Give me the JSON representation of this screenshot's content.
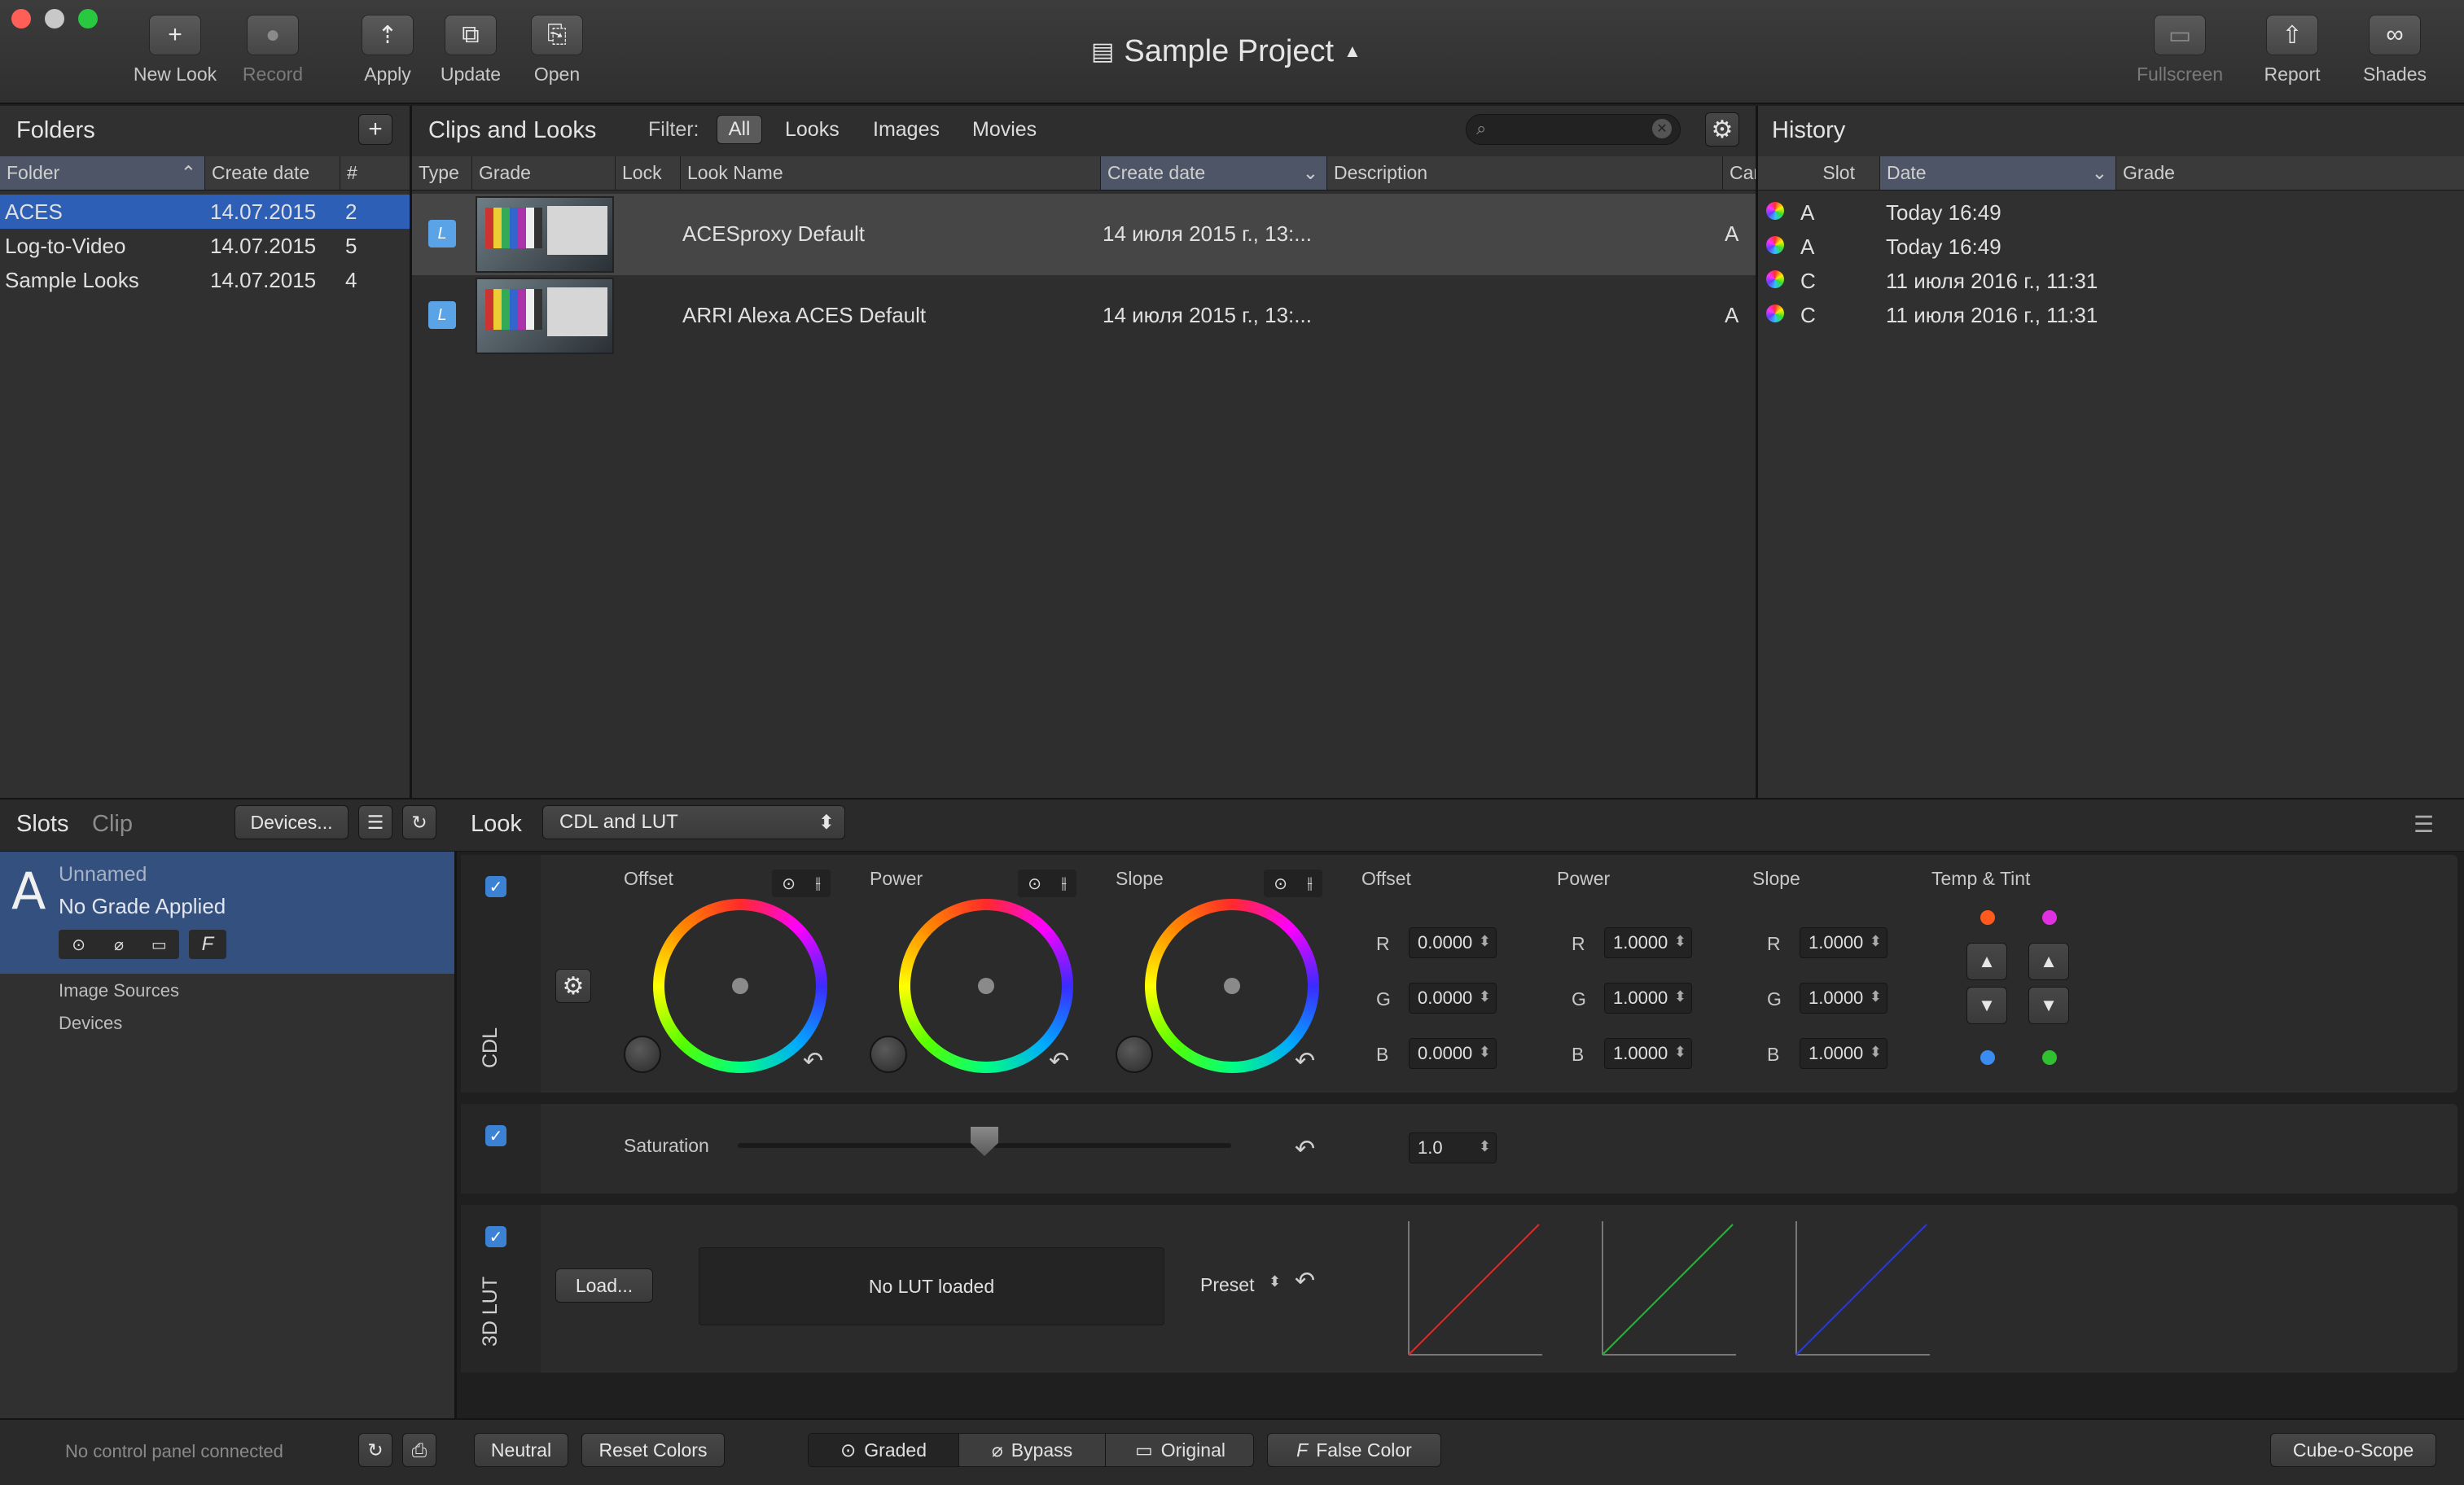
{
  "toolbar": {
    "new_look": "New Look",
    "record": "Record",
    "apply": "Apply",
    "update": "Update",
    "open": "Open",
    "project_title": "Sample Project",
    "fullscreen": "Fullscreen",
    "report": "Report",
    "shades": "Shades"
  },
  "folders": {
    "title": "Folders",
    "add": "+",
    "columns": [
      "Folder",
      "Create date",
      "#"
    ],
    "rows": [
      {
        "name": "ACES",
        "date": "14.07.2015",
        "count": "2"
      },
      {
        "name": "Log-to-Video",
        "date": "14.07.2015",
        "count": "5"
      },
      {
        "name": "Sample Looks",
        "date": "14.07.2015",
        "count": "4"
      }
    ]
  },
  "clips": {
    "title": "Clips and Looks",
    "filter_label": "Filter:",
    "filters": [
      "All",
      "Looks",
      "Images",
      "Movies"
    ],
    "columns": [
      "Type",
      "Grade",
      "Lock",
      "Look Name",
      "Create date",
      "Description",
      "Car"
    ],
    "rows": [
      {
        "type": "L",
        "name": "ACESproxy Default",
        "date": "14 июля 2015 г., 13:...",
        "car": "A"
      },
      {
        "type": "L",
        "name": "ARRI Alexa ACES Default",
        "date": "14 июля 2015 г., 13:...",
        "car": "A"
      }
    ]
  },
  "history": {
    "title": "History",
    "columns": [
      "Slot",
      "Date",
      "Grade"
    ],
    "rows": [
      {
        "slot": "A",
        "date": "Today 16:49"
      },
      {
        "slot": "A",
        "date": "Today 16:49"
      },
      {
        "slot": "C",
        "date": "11 июля 2016 г., 11:31"
      },
      {
        "slot": "C",
        "date": "11 июля 2016 г., 11:31"
      }
    ]
  },
  "slots": {
    "tab_slots": "Slots",
    "tab_clip": "Clip",
    "devices_btn": "Devices...",
    "slot_letter": "A",
    "slot_name": "Unnamed",
    "slot_status": "No Grade Applied",
    "f_label": "F",
    "image_sources": "Image Sources",
    "devices": "Devices"
  },
  "look": {
    "label": "Look",
    "select": "CDL and LUT",
    "cdl_label": "CDL",
    "wheels": [
      "Offset",
      "Power",
      "Slope"
    ],
    "offset": {
      "title": "Offset",
      "r": "0.0000",
      "g": "0.0000",
      "b": "0.0000"
    },
    "power": {
      "title": "Power",
      "r": "1.0000",
      "g": "1.0000",
      "b": "1.0000"
    },
    "slope": {
      "title": "Slope",
      "r": "1.0000",
      "g": "1.0000",
      "b": "1.0000"
    },
    "rgb": [
      "R",
      "G",
      "B"
    ],
    "temp_tint": "Temp & Tint",
    "saturation_label": "Saturation",
    "saturation_value": "1.0",
    "saturation_level": 0.5,
    "lut_label": "3D LUT",
    "load": "Load...",
    "no_lut": "No LUT loaded",
    "preset": "Preset"
  },
  "statusbar": {
    "control_panel": "No control panel connected",
    "neutral": "Neutral",
    "reset_colors": "Reset Colors",
    "graded": "Graded",
    "bypass": "Bypass",
    "original": "Original",
    "false_color": "False Color",
    "cube_scope": "Cube-o-Scope"
  },
  "colors": {
    "accent": "#3b82d4",
    "selection": "#2c5fb5",
    "curve_r": "#d23030",
    "curve_g": "#30b040",
    "curve_b": "#2a3ad0"
  }
}
